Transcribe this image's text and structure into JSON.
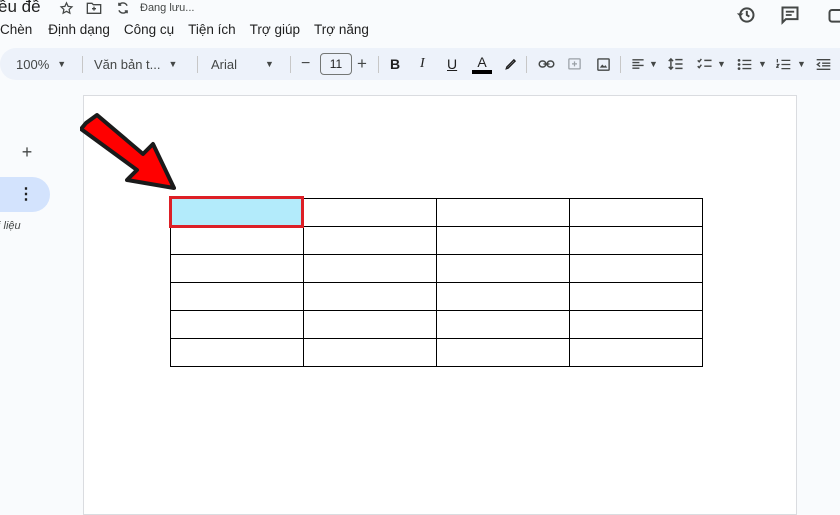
{
  "doc": {
    "title": "ều đề",
    "saving_status": "Đang lưu..."
  },
  "menu": {
    "items": [
      "Chèn",
      "Định dạng",
      "Công cụ",
      "Tiện ích",
      "Trợ giúp",
      "Trợ năng"
    ]
  },
  "toolbar": {
    "zoom": "100%",
    "style": "Văn bản t...",
    "font": "Arial",
    "font_size": "11",
    "decrease_size": "−",
    "increase_size": "+",
    "bold": "B",
    "italic": "I",
    "underline": "U",
    "text_color": "A"
  },
  "sidebar": {
    "add": "+",
    "more": "⋮",
    "label": "i liệu"
  },
  "table": {
    "rows": 6,
    "cols": 4,
    "selected_cell": [
      0,
      0
    ],
    "selected_color": "#b3ebfb"
  },
  "colors": {
    "accent": "#d3e3fd",
    "highlight_border": "#dd1f26",
    "arrow": "#ff0000"
  }
}
